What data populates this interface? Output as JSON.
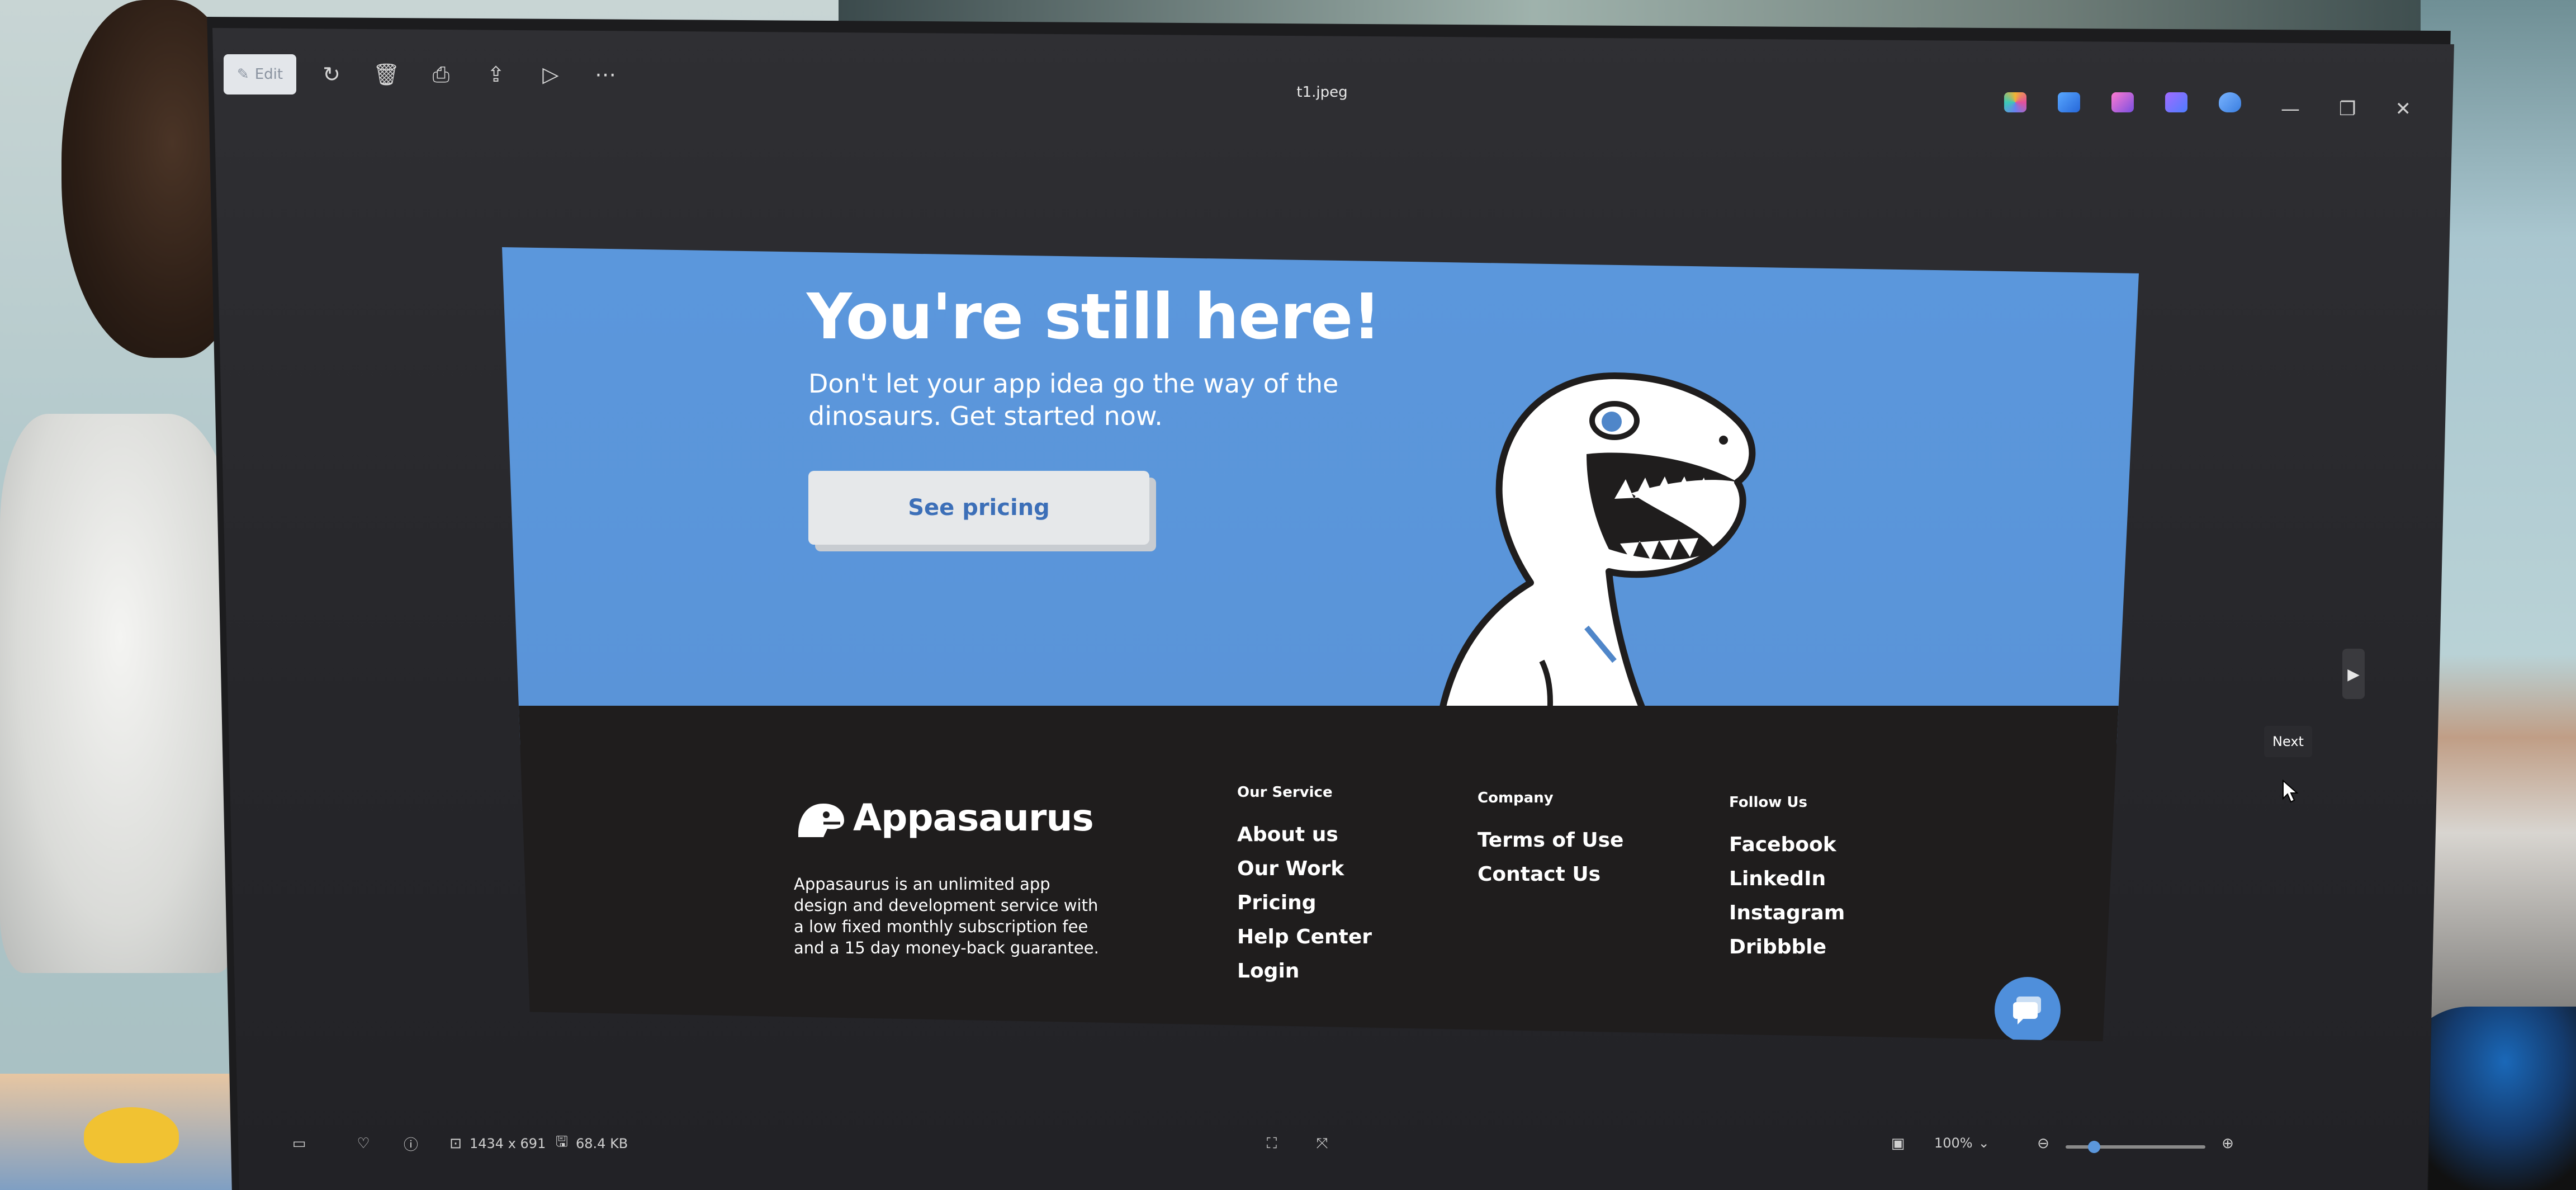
{
  "viewer": {
    "file_name": "t1.jpeg",
    "edit_label": "Edit",
    "next_label": "Next",
    "image_dims": "1434 x 691",
    "file_size": "68.4 KB",
    "zoom": "100%"
  },
  "page": {
    "hero_title": "You're still here!",
    "hero_subtitle": "Don't let your app idea go the way of the dinosaurs. Get started now.",
    "cta_label": "See pricing",
    "brand_name": "Appasaurus",
    "brand_description": "Appasaurus is an unlimited app design and development service with a low fixed monthly subscription fee and a 15 day money-back guarantee.",
    "our_service": {
      "heading": "Our Service",
      "links": [
        "About us",
        "Our Work",
        "Pricing",
        "Help Center",
        "Login"
      ]
    },
    "company": {
      "heading": "Company",
      "links": [
        "Terms of Use",
        "Contact Us"
      ]
    },
    "follow_us": {
      "heading": "Follow Us",
      "links": [
        "Facebook",
        "LinkedIn",
        "Instagram",
        "Dribbble"
      ]
    }
  },
  "colors": {
    "hero_blue": "#5b97dc",
    "footer_dark": "#1f1d1d",
    "cta_text": "#3c6fb8"
  }
}
